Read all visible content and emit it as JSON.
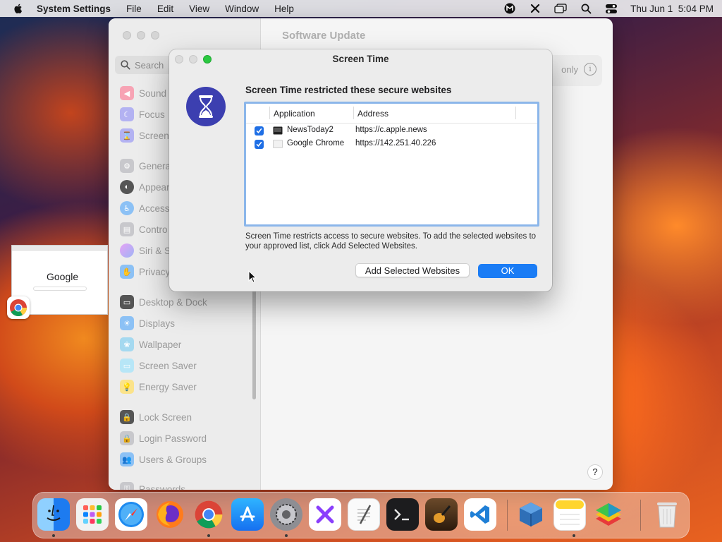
{
  "menubar": {
    "app_name": "System Settings",
    "menus": [
      "File",
      "Edit",
      "View",
      "Window",
      "Help"
    ],
    "clock": "Thu Jun 1  5:04 PM",
    "status_icons": [
      "malwarebytes-icon",
      "tools-icon",
      "screen-mirroring-icon",
      "spotlight-search-icon",
      "control-center-icon"
    ]
  },
  "settings": {
    "search_placeholder": "Search",
    "content_title": "Software Update",
    "content_row_text": "only",
    "help_label": "?",
    "sidebar": [
      {
        "label": "Sound",
        "icon": "sound-icon",
        "color": "#f2486a"
      },
      {
        "label": "Focus",
        "icon": "focus-icon",
        "color": "#5e5ce6"
      },
      {
        "label": "Screen",
        "icon": "screen-time-icon",
        "color": "#5e5ce6"
      },
      {
        "label": "Genera",
        "icon": "general-icon",
        "color": "#8e8e93"
      },
      {
        "label": "Appear",
        "icon": "appearance-icon",
        "color": "#1d1d1f"
      },
      {
        "label": "Access",
        "icon": "accessibility-icon",
        "color": "#0a84ff"
      },
      {
        "label": "Contro",
        "icon": "control-centre-icon",
        "color": "#8e8e93"
      },
      {
        "label": "Siri & S",
        "icon": "siri-icon",
        "color": "#bf5af2"
      },
      {
        "label": "Privacy",
        "icon": "privacy-icon",
        "color": "#0a84ff"
      },
      {
        "label": "Desktop & Dock",
        "icon": "desktop-dock-icon",
        "color": "#1d1d1f"
      },
      {
        "label": "Displays",
        "icon": "displays-icon",
        "color": "#0a84ff"
      },
      {
        "label": "Wallpaper",
        "icon": "wallpaper-icon",
        "color": "#32ade6"
      },
      {
        "label": "Screen Saver",
        "icon": "screen-saver-icon",
        "color": "#64d2ff"
      },
      {
        "label": "Energy Saver",
        "icon": "energy-saver-icon",
        "color": "#ffd60a"
      },
      {
        "label": "Lock Screen",
        "icon": "lock-screen-icon",
        "color": "#1d1d1f"
      },
      {
        "label": "Login Password",
        "icon": "login-password-icon",
        "color": "#8e8e93"
      },
      {
        "label": "Users & Groups",
        "icon": "users-groups-icon",
        "color": "#0a84ff"
      },
      {
        "label": "Passwords",
        "icon": "passwords-icon",
        "color": "#8e8e93"
      }
    ]
  },
  "chrome_preview": {
    "logo_text": "Google"
  },
  "dialog": {
    "title": "Screen Time",
    "heading": "Screen Time restricted these secure websites",
    "columns": [
      "Application",
      "Address"
    ],
    "rows": [
      {
        "checked": true,
        "app": "NewsToday2",
        "address": "https://c.apple.news"
      },
      {
        "checked": true,
        "app": "Google Chrome",
        "address": "https://142.251.40.226"
      }
    ],
    "description": "Screen Time restricts access to secure websites. To add the selected websites to your approved list, click Add Selected Websites.",
    "secondary_button": "Add Selected Websites",
    "primary_button": "OK",
    "accent_color": "#1a7cf5"
  },
  "dock": {
    "apps": [
      "Finder",
      "Launchpad",
      "Safari",
      "Firefox",
      "Google Chrome",
      "App Store",
      "System Settings",
      "Xcode Tools",
      "TextEdit",
      "Terminal",
      "GarageBand",
      "Visual Studio Code",
      "VirtualBox",
      "Notes",
      "BlueStacks",
      "Trash"
    ]
  }
}
